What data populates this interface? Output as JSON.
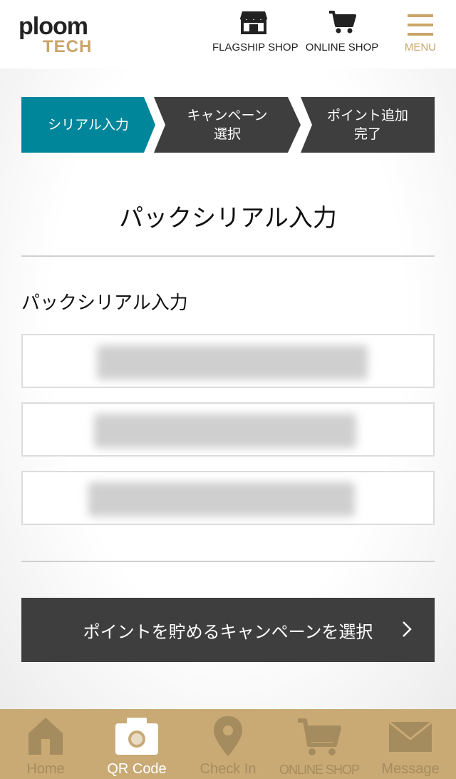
{
  "header": {
    "logo_primary": "ploom",
    "logo_secondary": "TECH",
    "flagship_label": "FLAGSHIP SHOP",
    "online_label": "ONLINE SHOP",
    "menu_label": "MENU"
  },
  "steps": [
    {
      "label": "シリアル入力",
      "state": "active"
    },
    {
      "label": "キャンペーン\n選択",
      "state": "pending"
    },
    {
      "label": "ポイント追加\n完了",
      "state": "pending"
    }
  ],
  "page_title": "パックシリアル入力",
  "section_label": "パックシリアル入力",
  "serial_fields": [
    {
      "value": "",
      "blurred": true
    },
    {
      "value": "",
      "blurred": true
    },
    {
      "value": "",
      "blurred": true
    }
  ],
  "cta_label": "ポイントを貯めるキャンペーンを選択",
  "tabbar": [
    {
      "label": "Home",
      "icon": "home-icon",
      "active": false
    },
    {
      "label": "QR Code",
      "icon": "camera-icon",
      "active": true
    },
    {
      "label": "Check In",
      "icon": "location-pin-icon",
      "active": false
    },
    {
      "label": "ONLINE SHOP",
      "icon": "cart-icon",
      "active": false
    },
    {
      "label": "Message",
      "icon": "envelope-icon",
      "active": false
    }
  ],
  "colors": {
    "accent": "#00869b",
    "dark": "#3e3e3e",
    "gold": "#c9aa75",
    "gold_text": "#c9a56a"
  }
}
